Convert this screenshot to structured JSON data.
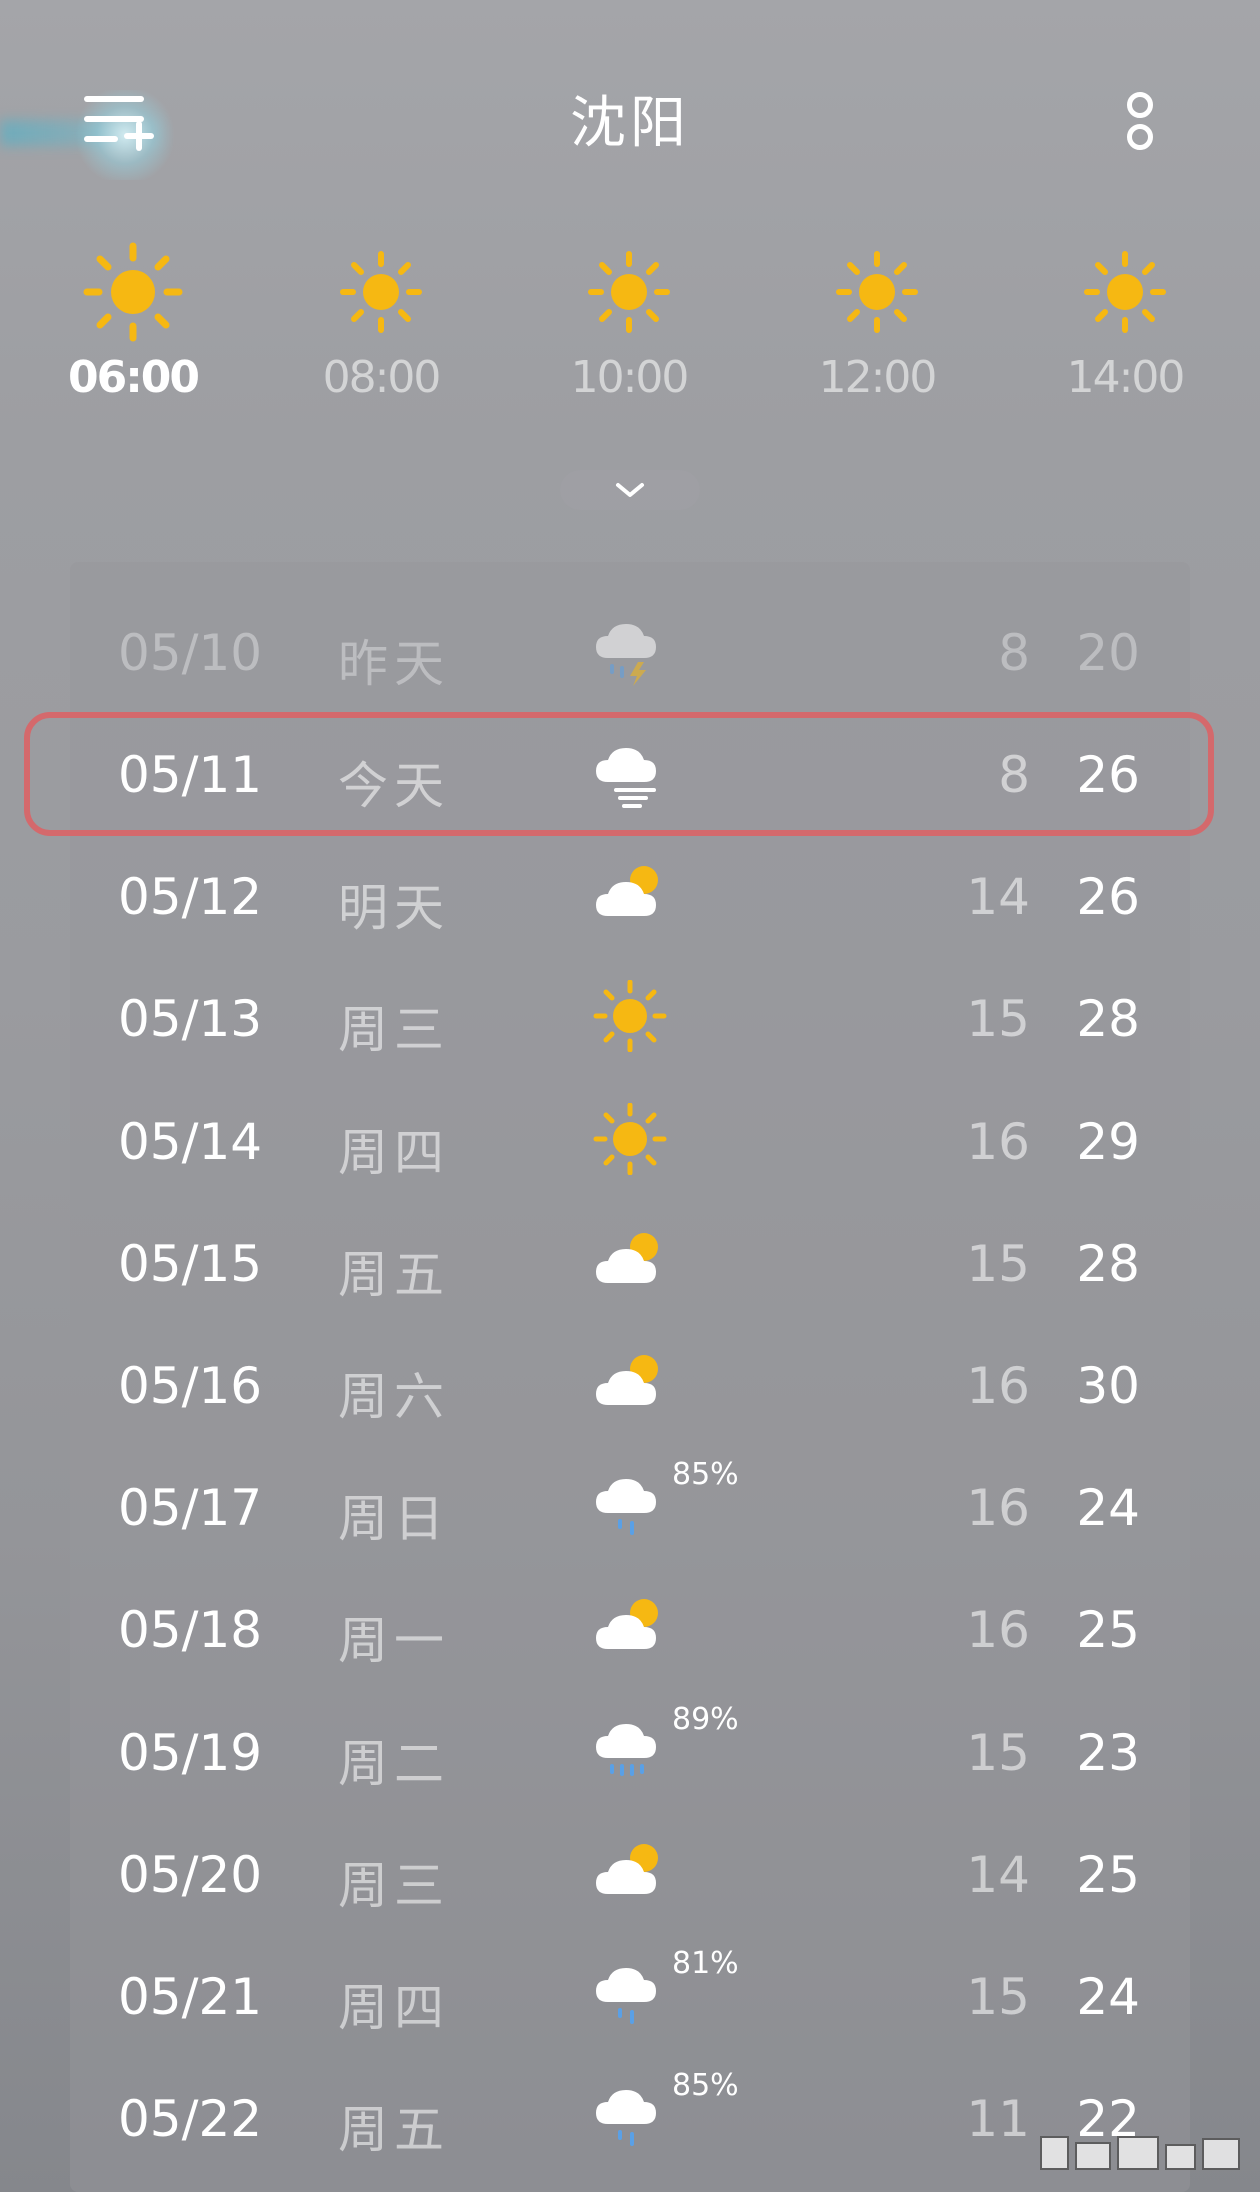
{
  "header": {
    "city": "沈阳",
    "menu_icon": "add-city-menu-icon",
    "more_icon": "more-options-icon"
  },
  "hourly": [
    {
      "time": "06:00",
      "icon": "sunny",
      "active": true
    },
    {
      "time": "08:00",
      "icon": "sunny",
      "active": false
    },
    {
      "time": "10:00",
      "icon": "sunny",
      "active": false
    },
    {
      "time": "12:00",
      "icon": "sunny",
      "active": false
    },
    {
      "time": "14:00",
      "icon": "sunny",
      "active": false
    }
  ],
  "expand_icon": "chevron-down-icon",
  "colors": {
    "sun": "#f6b812",
    "highlight_border": "#d4696c",
    "rain": "#5aa0e6",
    "lightning": "#f6b812"
  },
  "forecast": [
    {
      "date": "05/10",
      "day": "昨天",
      "icon": "thunder-shower",
      "prob": "",
      "low": "8",
      "high": "20",
      "past": true
    },
    {
      "date": "05/11",
      "day": "今天",
      "icon": "haze-cloud",
      "prob": "",
      "low": "8",
      "high": "26",
      "highlighted": true
    },
    {
      "date": "05/12",
      "day": "明天",
      "icon": "partly-cloudy",
      "prob": "",
      "low": "14",
      "high": "26"
    },
    {
      "date": "05/13",
      "day": "周三",
      "icon": "sunny",
      "prob": "",
      "low": "15",
      "high": "28"
    },
    {
      "date": "05/14",
      "day": "周四",
      "icon": "sunny",
      "prob": "",
      "low": "16",
      "high": "29"
    },
    {
      "date": "05/15",
      "day": "周五",
      "icon": "partly-cloudy",
      "prob": "",
      "low": "15",
      "high": "28"
    },
    {
      "date": "05/16",
      "day": "周六",
      "icon": "partly-cloudy",
      "prob": "",
      "low": "16",
      "high": "30"
    },
    {
      "date": "05/17",
      "day": "周日",
      "icon": "light-rain",
      "prob": "85%",
      "low": "16",
      "high": "24"
    },
    {
      "date": "05/18",
      "day": "周一",
      "icon": "partly-cloudy",
      "prob": "",
      "low": "16",
      "high": "25"
    },
    {
      "date": "05/19",
      "day": "周二",
      "icon": "rain",
      "prob": "89%",
      "low": "15",
      "high": "23"
    },
    {
      "date": "05/20",
      "day": "周三",
      "icon": "partly-cloudy",
      "prob": "",
      "low": "14",
      "high": "25"
    },
    {
      "date": "05/21",
      "day": "周四",
      "icon": "light-rain",
      "prob": "81%",
      "low": "15",
      "high": "24"
    },
    {
      "date": "05/22",
      "day": "周五",
      "icon": "light-rain",
      "prob": "85%",
      "low": "11",
      "high": "22"
    }
  ]
}
